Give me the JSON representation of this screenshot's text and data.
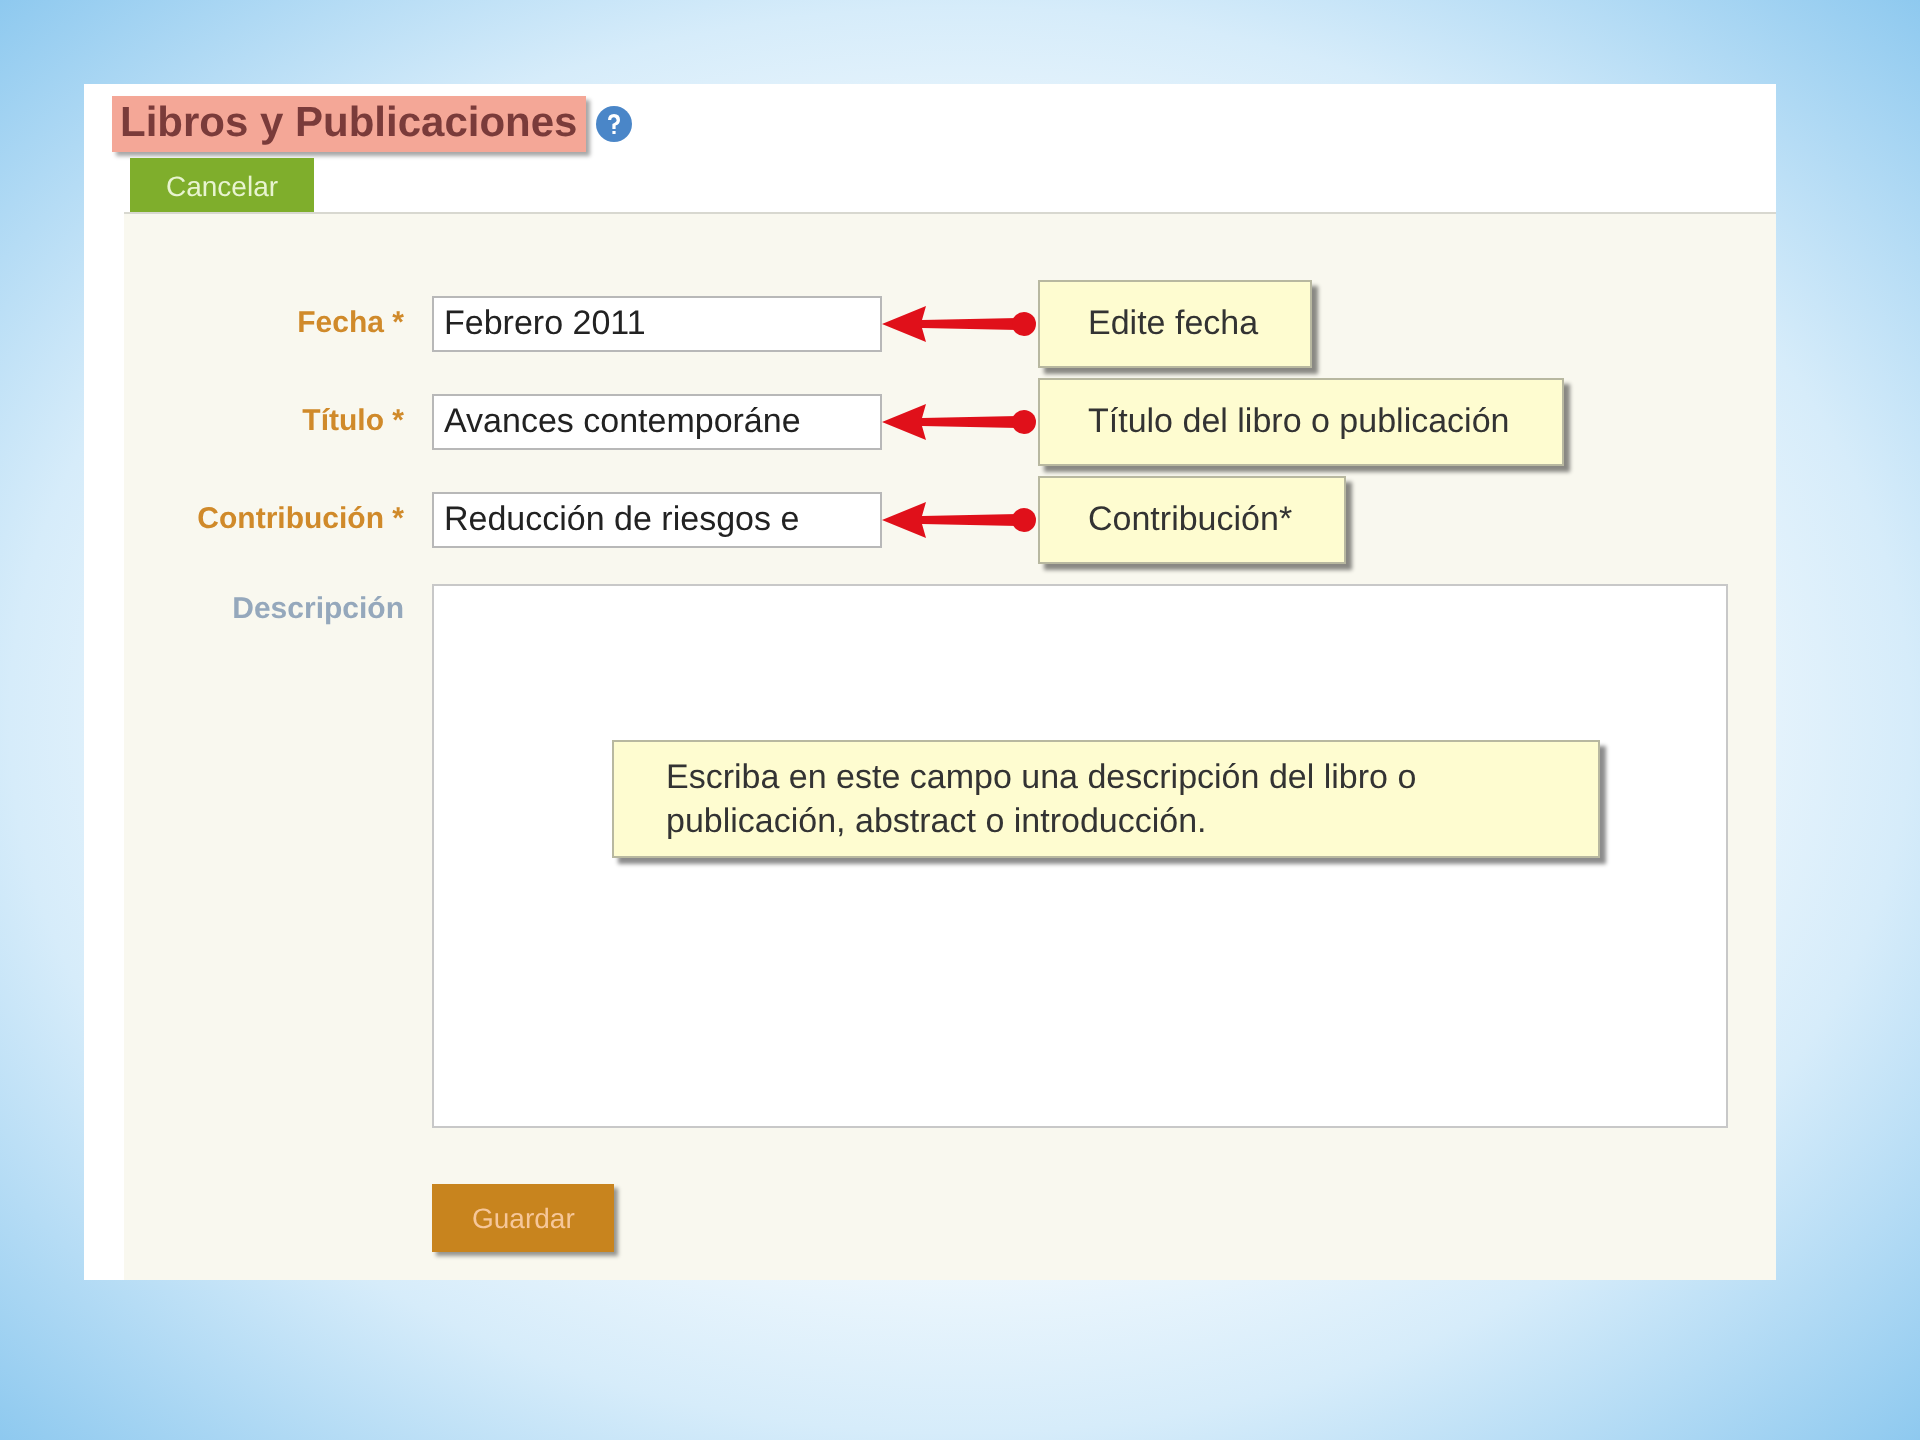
{
  "page": {
    "title": "Libros y Publicaciones",
    "cancel_button": "Cancelar"
  },
  "fields": [
    {
      "label": "Fecha *",
      "value": "Febrero 2011",
      "callout": "Edite fecha"
    },
    {
      "label": "Título *",
      "value": "Avances contemporáne",
      "callout": "Título del libro o publicación"
    },
    {
      "label": "Contribución *",
      "value": "Reducción de riesgos e",
      "callout": "Contribución*"
    }
  ],
  "description": {
    "label": "Descripción",
    "callout": "Escriba en este campo una descripción del libro o publicación, abstract o introducción."
  },
  "save_button": "Guardar"
}
